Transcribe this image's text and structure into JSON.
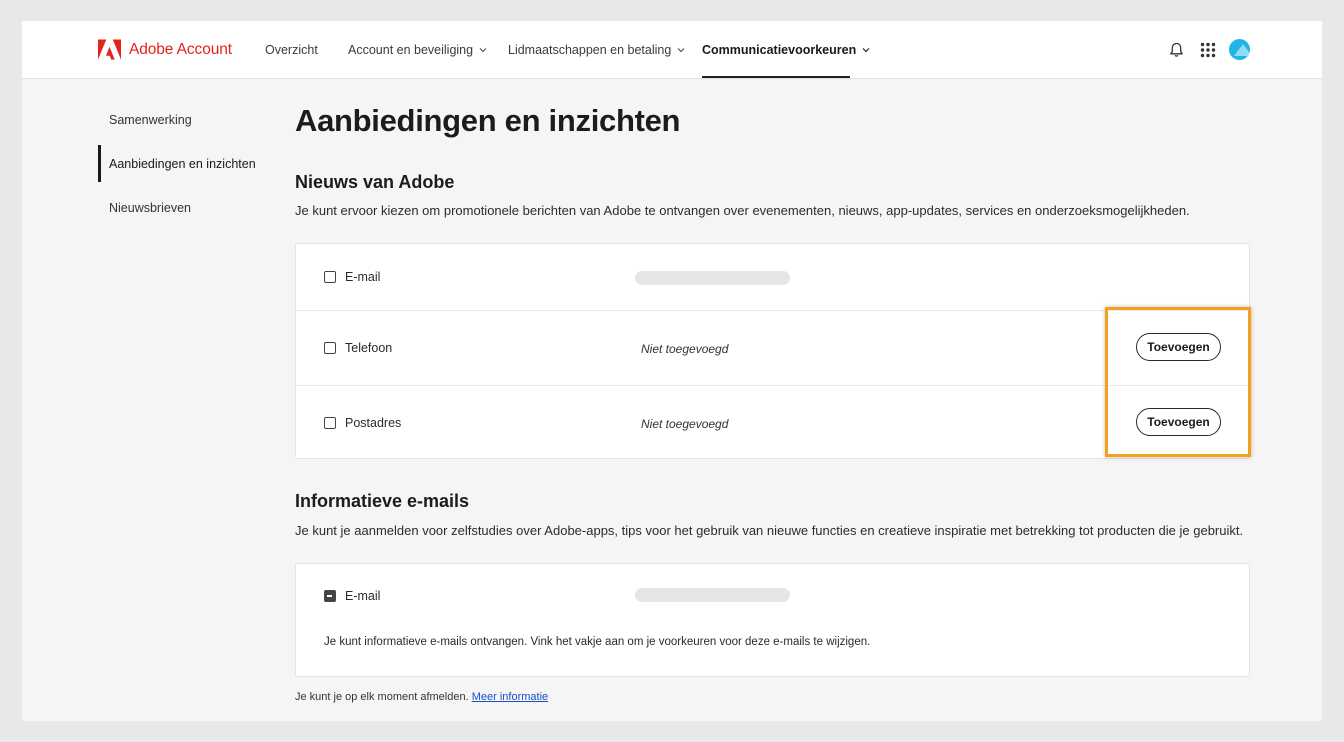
{
  "header": {
    "brand": "Adobe Account",
    "nav": [
      {
        "label": "Overzicht"
      },
      {
        "label": "Account en beveiliging"
      },
      {
        "label": "Lidmaatschappen en betaling"
      },
      {
        "label": "Communicatievoorkeuren"
      }
    ],
    "active_nav": "Communicatievoorkeuren",
    "brand_color": "#e1251b"
  },
  "sidebar": {
    "items": [
      {
        "label": "Samenwerking"
      },
      {
        "label": "Aanbiedingen en inzichten"
      },
      {
        "label": "Nieuwsbrieven"
      }
    ],
    "active": "Aanbiedingen en inzichten"
  },
  "main": {
    "title": "Aanbiedingen en inzichten",
    "section1": {
      "heading": "Nieuws van Adobe",
      "description": "Je kunt ervoor kiezen om promotionele berichten van Adobe te ontvangen over evenementen, nieuws, app-updates, services en onderzoeksmogelijkheden.",
      "rows": [
        {
          "label": "E-mail",
          "value": ""
        },
        {
          "label": "Telefoon",
          "value": "Niet toegevoegd",
          "button": "Toevoegen"
        },
        {
          "label": "Postadres",
          "value": "Niet toegevoegd",
          "button": "Toevoegen"
        }
      ]
    },
    "section2": {
      "heading": "Informatieve e-mails",
      "description": "Je kunt je aanmelden voor zelfstudies over Adobe-apps, tips voor het gebruik van nieuwe functies en creatieve inspiratie met betrekking tot producten die je gebruikt.",
      "row_label": "E-mail",
      "info": "Je kunt informatieve e-mails ontvangen. Vink het vakje aan om je voorkeuren voor deze e-mails te wijzigen."
    },
    "footer": {
      "text": "Je kunt je op elk moment afmelden.",
      "link": "Meer informatie"
    }
  },
  "highlight_color": "#f5a01a",
  "icons": [
    "adobe-logo-icon",
    "chevron-down-icon",
    "bell-icon",
    "app-grid-icon"
  ]
}
